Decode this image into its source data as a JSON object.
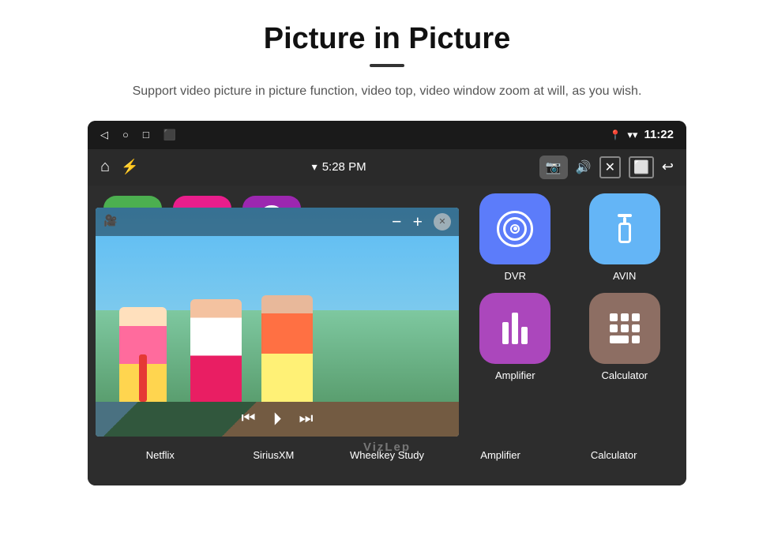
{
  "header": {
    "title": "Picture in Picture",
    "subtitle": "Support video picture in picture function, video top, video window zoom at will, as you wish."
  },
  "status_bar": {
    "time": "11:22",
    "wifi": "▾",
    "back_icon": "◁",
    "home_icon": "○",
    "recent_icon": "□",
    "screenshot_icon": "⬛"
  },
  "app_bar": {
    "home_icon": "⌂",
    "usb_icon": "⚡",
    "wifi_text": "5:28 PM",
    "camera_icon": "📷",
    "volume_icon": "🔊",
    "close_icon": "✕",
    "pip_icon": "⬜",
    "back_icon": "↩"
  },
  "video": {
    "minus_label": "−",
    "plus_label": "+",
    "close_label": "✕",
    "prev_label": "⏮",
    "play_label": "⏵",
    "next_label": "⏭"
  },
  "apps": {
    "top_row": [
      {
        "name": "netflix",
        "color": "#4caf50"
      },
      {
        "name": "siriusxm",
        "color": "#e91e8c"
      },
      {
        "name": "wheelkey",
        "color": "#9c27b0"
      }
    ],
    "right_grid": [
      {
        "id": "dvr",
        "label": "DVR",
        "color": "#5c7cfa"
      },
      {
        "id": "avin",
        "label": "AVIN",
        "color": "#64b5f6"
      },
      {
        "id": "amplifier",
        "label": "Amplifier",
        "color": "#ab47bc"
      },
      {
        "id": "calculator",
        "label": "Calculator",
        "color": "#8d6e63"
      }
    ],
    "bottom_labels": [
      {
        "id": "netflix",
        "label": "Netflix"
      },
      {
        "id": "siriusxm",
        "label": "SiriusXM"
      },
      {
        "id": "wheelkey",
        "label": "Wheelkey Study"
      },
      {
        "id": "amplifier",
        "label": "Amplifier"
      },
      {
        "id": "calculator",
        "label": "Calculator"
      }
    ]
  },
  "watermark": {
    "text": "VizLep"
  }
}
